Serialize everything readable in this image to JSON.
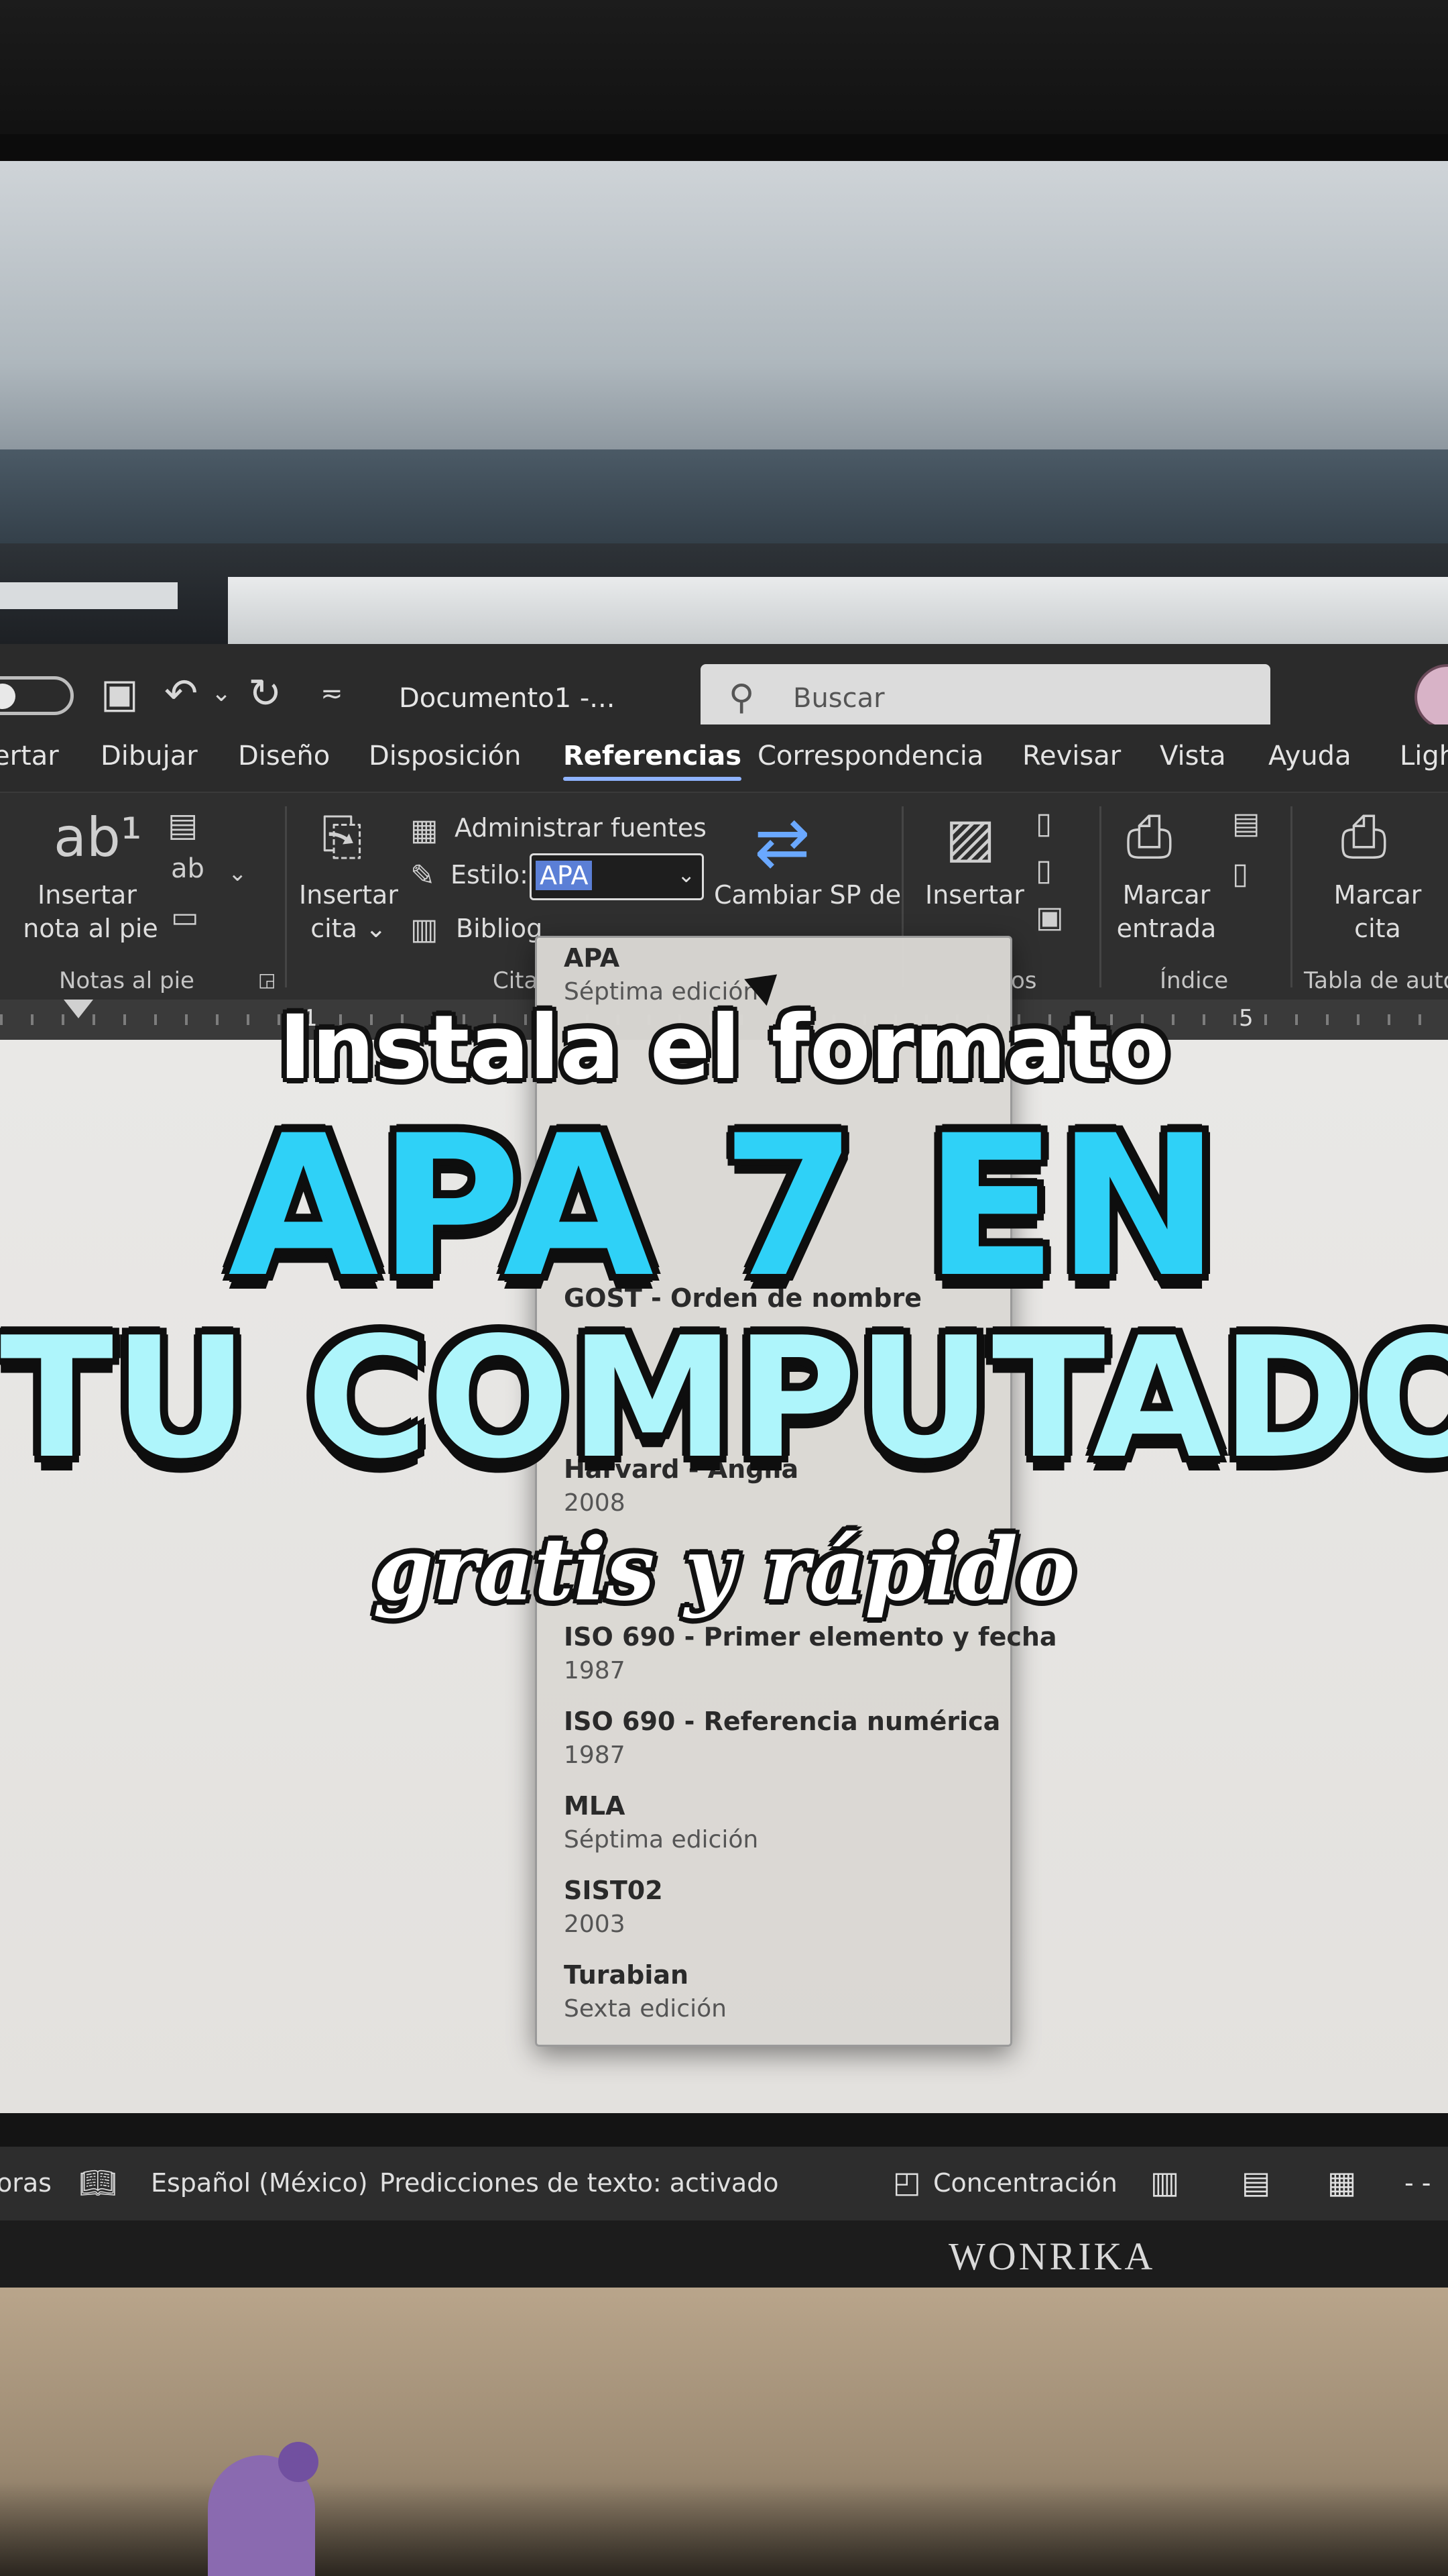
{
  "window": {
    "doc_title": "Documento1 -...",
    "search_placeholder": "Buscar"
  },
  "tabs": [
    {
      "label": "ertar"
    },
    {
      "label": "Dibujar"
    },
    {
      "label": "Diseño"
    },
    {
      "label": "Disposición"
    },
    {
      "label": "Referencias"
    },
    {
      "label": "Correspondencia"
    },
    {
      "label": "Revisar"
    },
    {
      "label": "Vista"
    },
    {
      "label": "Ayuda"
    },
    {
      "label": "Ligh"
    }
  ],
  "ribbon": {
    "insert_footnote_line1": "Insertar",
    "insert_footnote_line2": "nota al pie",
    "footnotes_group": "Notas al pie",
    "insert_citation_line1": "Insertar",
    "insert_citation_line2": "cita ⌄",
    "manage_sources": "Administrar fuentes",
    "style_label": "Estilo:",
    "style_value": "APA",
    "bibliography": "Bibliog",
    "citations_group": "Cita",
    "change_sp": "Cambiar SP de",
    "insert_caption": "Insertar",
    "captions_group": "os",
    "mark_entry_line1": "Marcar",
    "mark_entry_line2": "entrada",
    "index_group": "Índice",
    "mark_citation_line1": "Marcar",
    "mark_citation_line2": "cita",
    "authorities_group": "Tabla de auto"
  },
  "ruler": {
    "mark1": "1",
    "mark5": "5"
  },
  "dropdown": {
    "items": [
      {
        "name": "APA",
        "sub": "Séptima edición"
      },
      {
        "name": "GOST - Orden de nombre",
        "sub": ""
      },
      {
        "name": "Harvard - Anglia",
        "sub": "2008"
      },
      {
        "name": "ISO 690 - Primer elemento y fecha",
        "sub": "1987"
      },
      {
        "name": "ISO 690 - Referencia numérica",
        "sub": "1987"
      },
      {
        "name": "MLA",
        "sub": "Séptima edición"
      },
      {
        "name": "SIST02",
        "sub": "2003"
      },
      {
        "name": "Turabian",
        "sub": "Sexta edición"
      }
    ]
  },
  "status": {
    "left_partial": "oras",
    "language": "Español (México)",
    "predictions": "Predicciones de texto: activado",
    "focus": "Concentración",
    "zoom_minus": "- -"
  },
  "monitor_brand": "WONRIKA",
  "overlay": {
    "line1": "Instala el formato",
    "line2": "APA 7 EN",
    "line3": "TU COMPUTADORA",
    "line4": "gratis y rápido"
  },
  "colors": {
    "accent_blue": "#2fd1f7",
    "accent_light": "#aef5fb",
    "tab_underline": "#8fb3ff"
  }
}
